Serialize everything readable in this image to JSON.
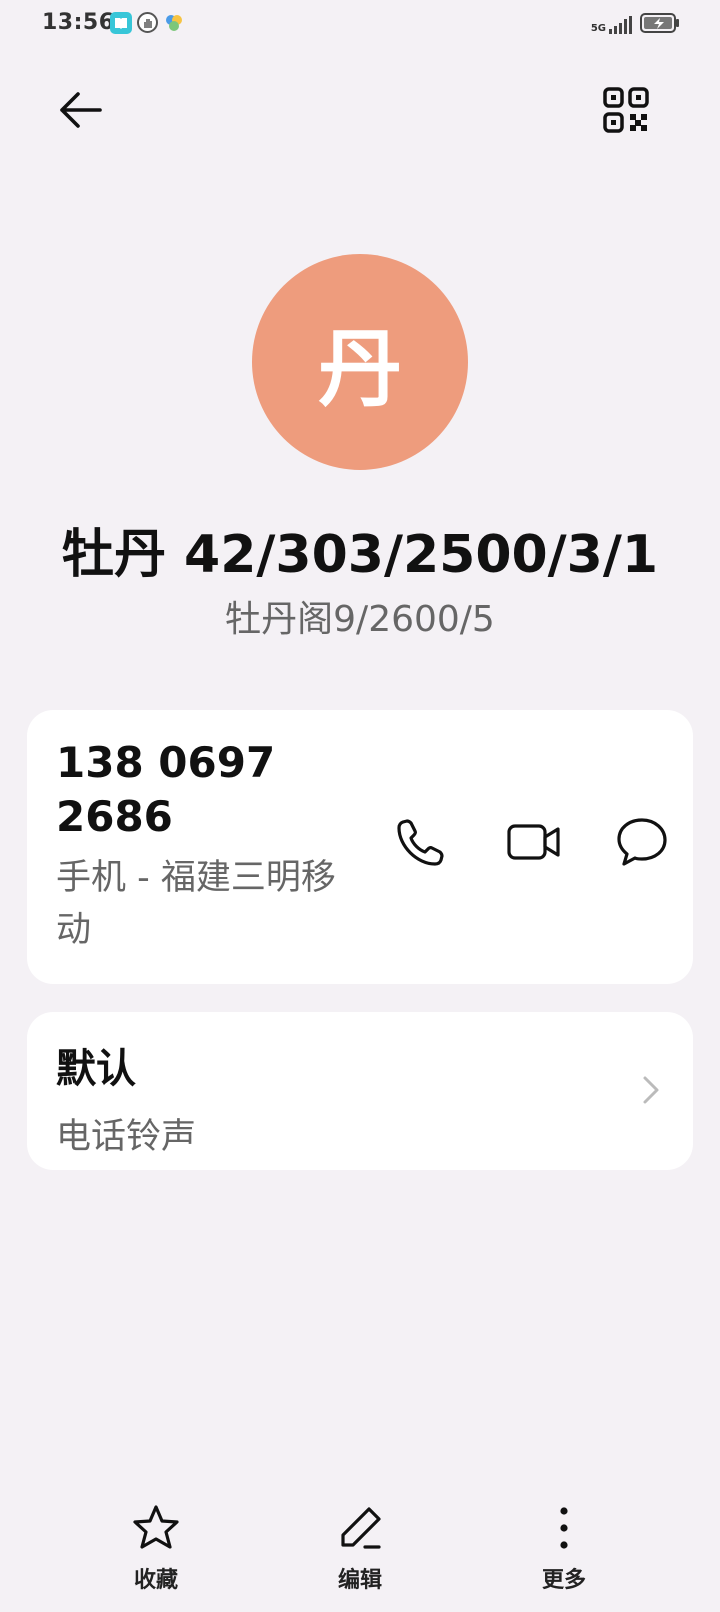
{
  "status_bar": {
    "time": "13:56",
    "network": "5G",
    "icons": [
      "book-app-icon",
      "hand-icon",
      "pinwheel-icon",
      "signal-icon",
      "battery-charging-icon"
    ]
  },
  "header": {
    "back_icon": "back-arrow-icon",
    "qr_icon": "qr-code-icon"
  },
  "contact": {
    "avatar_initial": "丹",
    "avatar_color": "#ee9c7d",
    "name": "牡丹 42/303/2500/3/1",
    "organization": "牡丹阁9/2600/5"
  },
  "phone_card": {
    "number": "138 0697 2686",
    "meta": "手机 - 福建三明移动",
    "actions": [
      {
        "name": "call",
        "icon": "phone-icon"
      },
      {
        "name": "video-call",
        "icon": "video-camera-icon"
      },
      {
        "name": "message",
        "icon": "message-bubble-icon"
      }
    ]
  },
  "ringtone_card": {
    "value": "默认",
    "label": "电话铃声"
  },
  "bottom_bar": {
    "favorite": "收藏",
    "edit": "编辑",
    "more": "更多"
  }
}
